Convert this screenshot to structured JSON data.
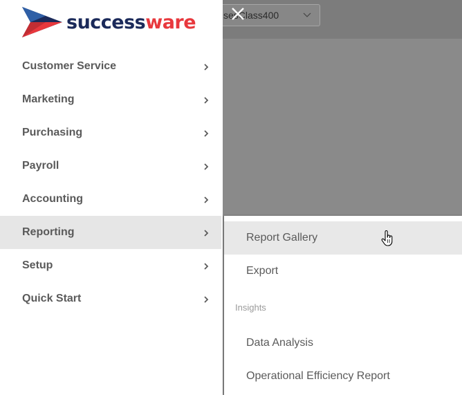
{
  "app": {
    "logo_part1": "success",
    "logo_part2": "ware",
    "brand_navy": "#1b2a5a",
    "brand_red": "#e8383d"
  },
  "background": {
    "select_value": "sesClass400"
  },
  "nav": {
    "items": [
      {
        "label": "Customer Service"
      },
      {
        "label": "Marketing"
      },
      {
        "label": "Purchasing"
      },
      {
        "label": "Payroll"
      },
      {
        "label": "Accounting"
      },
      {
        "label": "Reporting"
      },
      {
        "label": "Setup"
      },
      {
        "label": "Quick Start"
      }
    ],
    "active": "Reporting"
  },
  "submenu": {
    "items": [
      {
        "label": "Report Gallery"
      },
      {
        "label": "Export"
      }
    ],
    "section_heading": "Insights",
    "insights": [
      {
        "label": "Data Analysis"
      },
      {
        "label": "Operational Efficiency Report"
      }
    ]
  },
  "icons": {
    "close": "close-icon",
    "chevron_right": "chevron-right-icon",
    "chevron_down": "chevron-down-icon",
    "cursor": "hand-pointer-icon"
  }
}
